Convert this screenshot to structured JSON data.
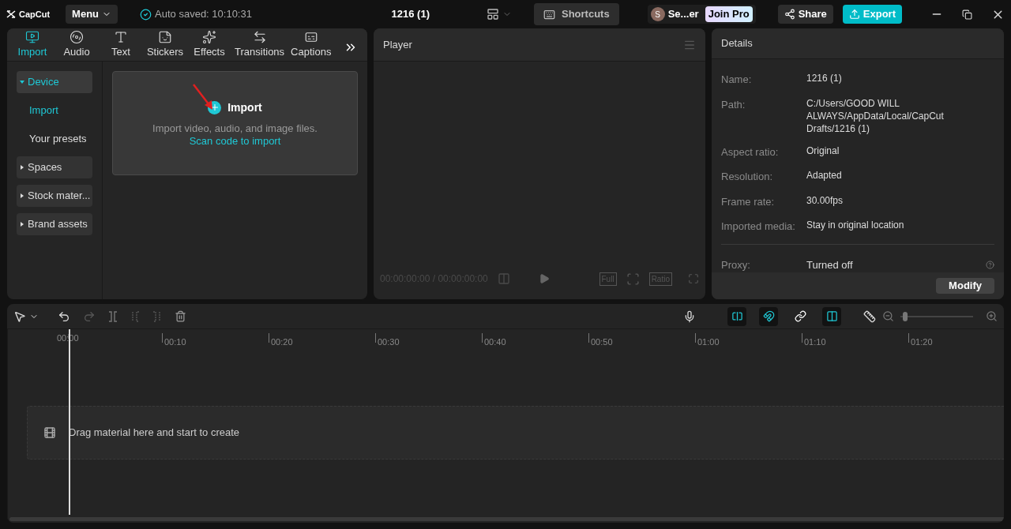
{
  "app": {
    "logo": "CapCut",
    "menu": "Menu",
    "autosave": "Auto saved: 10:10:31",
    "project_title": "1216 (1)",
    "shortcuts": "Shortcuts",
    "user_initial": "S",
    "user_name": "Se...er",
    "join_pro": "Join Pro",
    "share": "Share",
    "export": "Export"
  },
  "media_tabs": [
    {
      "label": "Import",
      "selected": true
    },
    {
      "label": "Audio",
      "selected": false
    },
    {
      "label": "Text",
      "selected": false
    },
    {
      "label": "Stickers",
      "selected": false
    },
    {
      "label": "Effects",
      "selected": false
    },
    {
      "label": "Transitions",
      "selected": false
    },
    {
      "label": "Captions",
      "selected": false
    }
  ],
  "sidebar": [
    {
      "label": "Device",
      "expanded": true,
      "selected": true,
      "children": [
        {
          "label": "Import",
          "selected": true
        },
        {
          "label": "Your presets",
          "selected": false
        }
      ]
    },
    {
      "label": "Spaces",
      "expanded": false,
      "selected": false
    },
    {
      "label": "Stock mater...",
      "expanded": false,
      "selected": false
    },
    {
      "label": "Brand assets",
      "expanded": false,
      "selected": false
    }
  ],
  "import_card": {
    "title": "Import",
    "text": "Import video, audio, and image files.",
    "link": "Scan code to import"
  },
  "player": {
    "title": "Player",
    "timecode": "00:00:00:00 / 00:00:00:00",
    "full": "Full",
    "ratio": "Ratio"
  },
  "details": {
    "title": "Details",
    "rows": [
      {
        "label": "Name:",
        "value": "1216 (1)"
      },
      {
        "label": "Path:",
        "value": "C:/Users/GOOD WILL ALWAYS/AppData/Local/CapCut Drafts/1216 (1)"
      },
      {
        "label": "Aspect ratio:",
        "value": "Original"
      },
      {
        "label": "Resolution:",
        "value": "Adapted"
      },
      {
        "label": "Frame rate:",
        "value": "30.00fps"
      },
      {
        "label": "Imported media:",
        "value": "Stay in original location"
      }
    ],
    "proxy": {
      "label": "Proxy:",
      "value": "Turned off"
    },
    "modify": "Modify"
  },
  "timeline": {
    "toggles": [
      {
        "kind": "main-track",
        "on": true
      },
      {
        "kind": "snap",
        "on": true
      },
      {
        "kind": "link",
        "on": false
      },
      {
        "kind": "preview-axis",
        "on": true
      }
    ],
    "zoom": {
      "level": 0.03
    },
    "ruler": [
      "00:00",
      "00:10",
      "00:20",
      "00:30",
      "00:40",
      "00:50",
      "01:00",
      "01:10",
      "01:20"
    ],
    "drop_hint": "Drag material here and start to create"
  }
}
